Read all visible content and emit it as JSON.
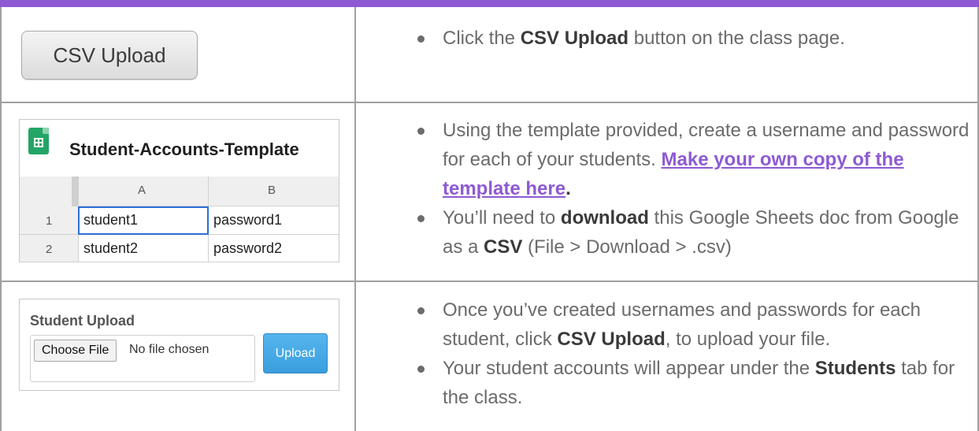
{
  "colors": {
    "accent": "#8e5ad3",
    "grid": "#a0a0a0",
    "upload_blue": "#3a9ede",
    "sheets_green": "#23a566"
  },
  "row1": {
    "button_label": "CSV Upload",
    "bullet1": {
      "pre": "Click the ",
      "bold": "CSV Upload",
      "post": " button on the class page."
    }
  },
  "row2": {
    "sheet": {
      "icon": "google-sheets-icon",
      "title": "Student-Accounts-Template",
      "col_headers": [
        "A",
        "B"
      ],
      "rows": [
        {
          "num": "1",
          "a": "student1",
          "b": "password1"
        },
        {
          "num": "2",
          "a": "student2",
          "b": "password2"
        }
      ]
    },
    "bullet1": {
      "line1": "Using the template provided, create a username and",
      "pre": "password for each of your students. ",
      "link": "Make your own copy of the template here",
      "post": "."
    },
    "bullet2": {
      "pre": "You’ll need to ",
      "bold1": "download",
      "mid": " this Google Sheets doc from Google as a ",
      "bold2": "CSV",
      "post": " (File > Download > .csv)"
    }
  },
  "row3": {
    "widget": {
      "title": "Student Upload",
      "choose_label": "Choose File",
      "no_file": "No file chosen",
      "upload_label": "Upload"
    },
    "bullet1": {
      "pre": "Once you’ve created usernames and passwords for each student, click ",
      "bold": "CSV Upload",
      "post": ", to upload your file."
    },
    "bullet2": {
      "pre": "Your student accounts will appear under the ",
      "bold": "Students",
      "post": " tab for the class."
    }
  }
}
